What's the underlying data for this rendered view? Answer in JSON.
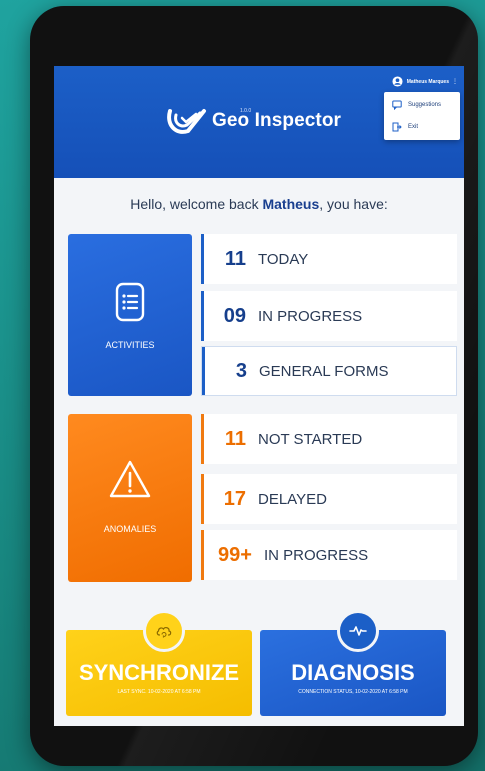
{
  "header": {
    "logo_text": "Geo Inspector",
    "logo_version": "1.0.0",
    "user_name": "Matheus Marques",
    "menu": [
      {
        "label": "Suggestions",
        "icon": "chat-icon"
      },
      {
        "label": "Exit",
        "icon": "exit-icon"
      }
    ]
  },
  "welcome": {
    "prefix": "Hello, welcome back ",
    "name": "Matheus",
    "suffix": ", you have:"
  },
  "activities": {
    "label": "ACTIVITIES",
    "icon": "document-list-icon",
    "items": [
      {
        "count": "11",
        "label": "TODAY"
      },
      {
        "count": "09",
        "label": "IN PROGRESS"
      },
      {
        "count": "3",
        "label": "GENERAL FORMS"
      }
    ]
  },
  "anomalies": {
    "label": "ANOMALIES",
    "icon": "warning-icon",
    "items": [
      {
        "count": "11",
        "label": "NOT STARTED"
      },
      {
        "count": "17",
        "label": "DELAYED"
      },
      {
        "count": "99+",
        "label": "IN PROGRESS"
      }
    ]
  },
  "synchronize": {
    "title": "SYNCHRONIZE",
    "subtitle": "LAST SYNC. 10-02-2020 AT 6:58 PM",
    "icon": "cloud-sync-icon"
  },
  "diagnosis": {
    "title": "DIAGNOSIS",
    "subtitle": "CONNECTION STATUS, 10-02-2020 AT 6:58 PM",
    "icon": "pulse-icon"
  },
  "colors": {
    "brand_blue": "#1c5fc7",
    "accent_orange": "#f07a10",
    "accent_yellow": "#ffd21a",
    "background": "#1fa39f"
  }
}
